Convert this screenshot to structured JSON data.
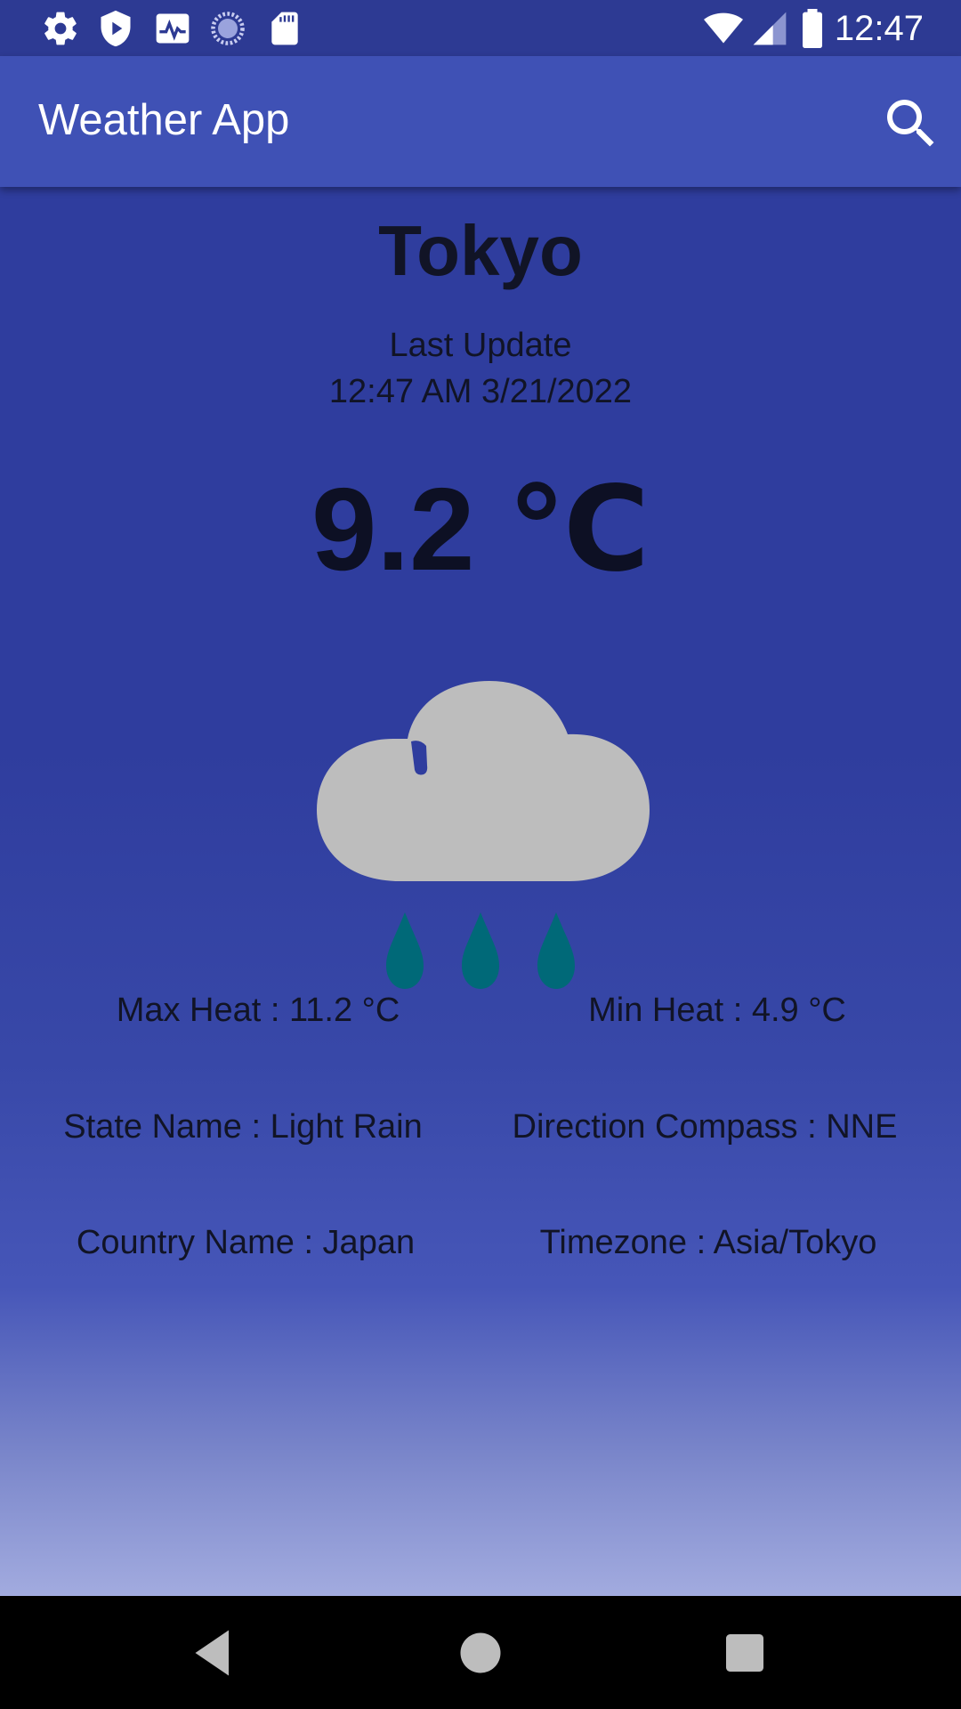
{
  "status_bar": {
    "time": "12:47",
    "left_icons": [
      "settings-icon",
      "shield-play-icon",
      "activity-monitor-icon",
      "loading-circle-icon",
      "sd-card-icon"
    ],
    "right_icons": [
      "wifi-icon",
      "cellular-signal-icon",
      "battery-icon"
    ]
  },
  "app_bar": {
    "title": "Weather App",
    "search_icon": "search-icon"
  },
  "weather": {
    "city": "Tokyo",
    "last_update_label": "Last Update",
    "last_update_time": "12:47 AM 3/21/2022",
    "temperature": "9.2 ℃",
    "icon": "light-rain-icon"
  },
  "details": {
    "max_heat": "Max Heat : 11.2 °C",
    "min_heat": "Min Heat : 4.9 °C",
    "state_name": "State Name : Light Rain",
    "direction_compass": "Direction Compass : NNE",
    "country_name": "Country Name : Japan",
    "timezone": "Timezone : Asia/Tokyo"
  },
  "nav_bar": {
    "icons": [
      "back-icon",
      "home-icon",
      "recents-icon"
    ]
  },
  "colors": {
    "status_bar": "#2d3a93",
    "app_bar": "#3f51b5",
    "background": "#2f3d9e",
    "cloud": "#bdbdbd",
    "rain_drop": "#006978",
    "text": "#111426"
  }
}
